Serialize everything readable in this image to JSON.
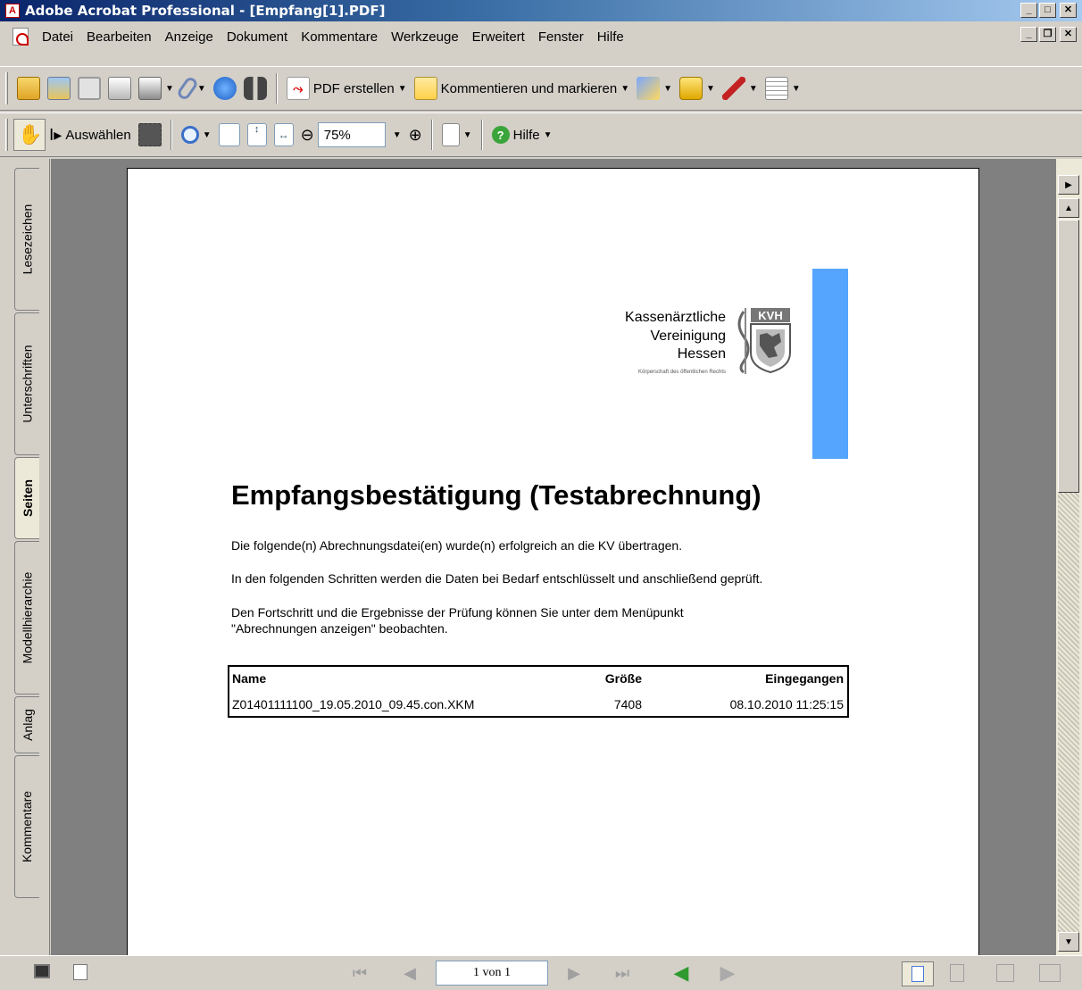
{
  "window": {
    "title": "Adobe Acrobat Professional - [Empfang[1].PDF]"
  },
  "menu": [
    "Datei",
    "Bearbeiten",
    "Anzeige",
    "Dokument",
    "Kommentare",
    "Werkzeuge",
    "Erweitert",
    "Fenster",
    "Hilfe"
  ],
  "toolbar1": {
    "create_pdf": "PDF erstellen",
    "comment": "Kommentieren und markieren"
  },
  "toolbar2": {
    "select": "Auswählen",
    "zoom": "75%",
    "help": "Hilfe"
  },
  "side_tabs": [
    "Lesezeichen",
    "Unterschriften",
    "Seiten",
    "Modellhierarchie",
    "Anlag",
    "Kommentare"
  ],
  "document": {
    "logo_line1": "Kassenärztliche",
    "logo_line2": "Vereinigung",
    "logo_line3": "Hessen",
    "logo_sub": "Körperschaft des öffentlichen Rechts",
    "logo_badge": "KVH",
    "title": "Empfangsbestätigung (Testabrechnung)",
    "para1": "Die folgende(n) Abrechnungsdatei(en) wurde(n) erfolgreich an die KV übertragen.",
    "para2": "In den folgenden Schritten werden die Daten bei Bedarf entschlüsselt und anschließend geprüft.",
    "para3a": "Den Fortschritt und die Ergebnisse der Prüfung können Sie unter dem Menüpunkt",
    "para3b": "\"Abrechnungen anzeigen\" beobachten.",
    "table": {
      "headers": [
        "Name",
        "Größe",
        "Eingegangen"
      ],
      "row": [
        "Z01401111100_19.05.2010_09.45.con.XKM",
        "7408",
        "08.10.2010 11:25:15"
      ]
    }
  },
  "status": {
    "page_indicator": "1 von 1"
  },
  "colors": {
    "accent_bar": "#55a5ff",
    "title_bar": "#0a246a"
  }
}
